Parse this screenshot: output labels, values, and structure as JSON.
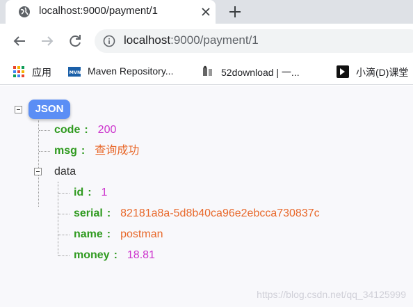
{
  "tab": {
    "title": "localhost:9000/payment/1"
  },
  "omnibox": {
    "host": "localhost",
    "rest": ":9000/payment/1"
  },
  "bookmarks": [
    {
      "label": "应用",
      "icon": "apps-grid-icon"
    },
    {
      "label": "Maven Repository...",
      "icon": "mvn-icon"
    },
    {
      "label": "52download | 一...",
      "icon": "download-site-icon"
    },
    {
      "label": "小滴(D)课堂",
      "icon": "xiaodi-icon"
    }
  ],
  "json_viewer": {
    "root_label": "JSON",
    "code": {
      "key": "code",
      "value": "200"
    },
    "msg": {
      "key": "msg",
      "value": "查询成功"
    },
    "data": {
      "key": "data",
      "id": {
        "key": "id",
        "value": "1"
      },
      "serial": {
        "key": "serial",
        "value": "82181a8a-5d8b40ca96e2ebcca730837c"
      },
      "name": {
        "key": "name",
        "value": "postman"
      },
      "money": {
        "key": "money",
        "value": "18.81"
      }
    }
  },
  "watermark": "https://blog.csdn.net/qq_34125999",
  "colors": {
    "key": "#2f9a1f",
    "number": "#cc33cc",
    "string": "#e8682a",
    "badge": "#5b8ef5"
  }
}
